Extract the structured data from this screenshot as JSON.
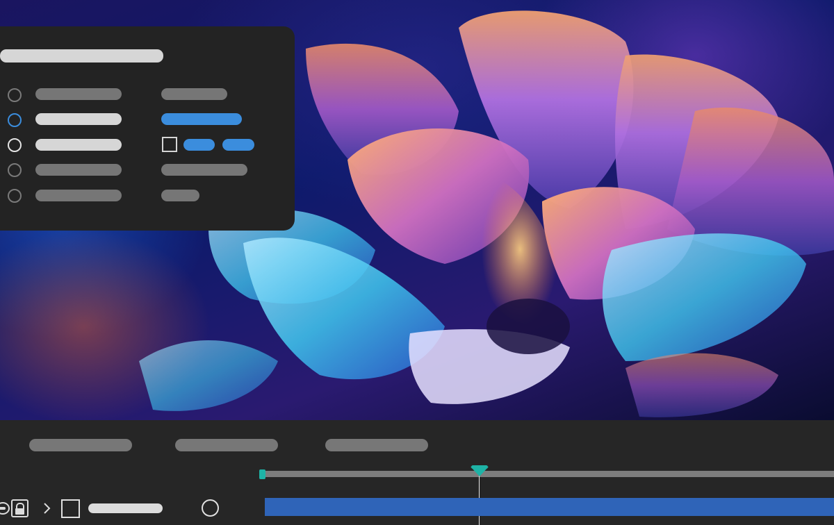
{
  "app": {
    "accent_color": "#3b8ddd",
    "teal_color": "#1eb3a6"
  },
  "canvas": {
    "description_icon": "artwork-image"
  },
  "panel": {
    "rows": [
      {
        "radio": "unselected",
        "label": "",
        "value": ""
      },
      {
        "radio": "selected",
        "label": "",
        "value": ""
      },
      {
        "radio": "active",
        "label": "",
        "value": "",
        "checkbox": "unchecked"
      },
      {
        "radio": "unselected",
        "label": "",
        "value": ""
      },
      {
        "radio": "unselected",
        "label": "",
        "value": ""
      }
    ]
  },
  "timeline": {
    "tabs": [
      "",
      "",
      ""
    ],
    "layer": {
      "name": "",
      "icons": [
        "eye-icon",
        "lock-icon",
        "chevron-right-icon",
        "square-icon",
        "circle-icon"
      ]
    },
    "playhead_fraction": 0.38
  }
}
